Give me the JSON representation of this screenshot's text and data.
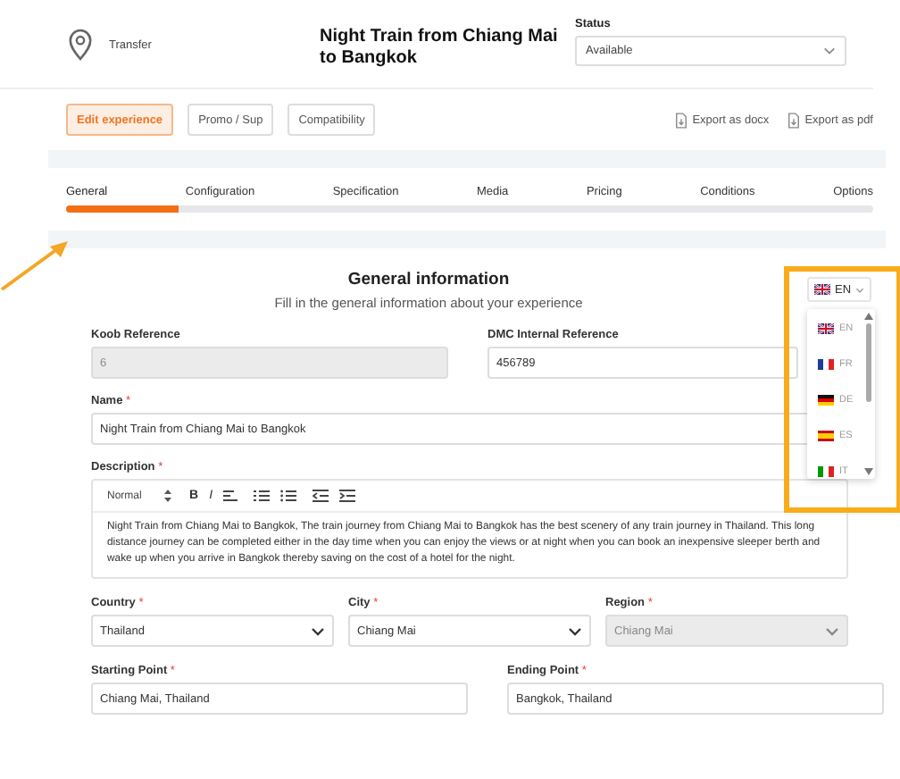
{
  "header": {
    "category": "Transfer",
    "title": "Night Train from Chiang Mai to Bangkok",
    "status": {
      "label": "Status",
      "value": "Available"
    }
  },
  "actions": [
    {
      "label": "Edit experience",
      "selected": true
    },
    {
      "label": "Promo / Sup",
      "selected": false
    },
    {
      "label": "Compatibility",
      "selected": false
    }
  ],
  "exports": [
    "Export as docx",
    "Export as pdf"
  ],
  "tabs": [
    {
      "label": "General",
      "selected": true
    },
    {
      "label": "Configuration",
      "selected": false
    },
    {
      "label": "Specification",
      "selected": false
    },
    {
      "label": "Media",
      "selected": false
    },
    {
      "label": "Pricing",
      "selected": false
    },
    {
      "label": "Conditions",
      "selected": false
    },
    {
      "label": "Options",
      "selected": false
    }
  ],
  "progress": {
    "level": 0.14
  },
  "section": {
    "title": "General information",
    "subtitle": "Fill in the general information about your experience"
  },
  "language": {
    "value": "EN",
    "kind": "uk",
    "options": [
      {
        "code": "EN",
        "kind": "uk"
      },
      {
        "code": "FR",
        "kind": "fr"
      },
      {
        "code": "DE",
        "kind": "de"
      },
      {
        "code": "ES",
        "kind": "es"
      },
      {
        "code": "IT",
        "kind": "it"
      }
    ]
  },
  "references": [
    {
      "label": "Koob Reference",
      "value": "6",
      "disabled": true
    },
    {
      "label": "DMC Internal Reference",
      "value": "456789",
      "disabled": false
    }
  ],
  "name": {
    "label": "Name",
    "mark": "*",
    "value": "Night Train from Chiang Mai to Bangkok"
  },
  "description": {
    "label": "Description",
    "mark": "*",
    "format": "Normal",
    "bold": "B",
    "italic": "I",
    "text": "Night Train from Chiang Mai to Bangkok, The train journey from Chiang Mai to Bangkok has the best scenery of any train journey in Thailand. This long distance journey can be completed either in the day time when you can enjoy the views or at night when you can book an inexpensive sleeper berth and wake up when you arrive in Bangkok thereby saving on the cost of a hotel for the night."
  },
  "location": [
    {
      "label": "Country",
      "mark": "*",
      "value": "Thailand",
      "disabled": false
    },
    {
      "label": "City",
      "mark": "*",
      "value": "Chiang Mai",
      "disabled": false
    },
    {
      "label": "Region",
      "mark": "*",
      "value": "Chiang Mai",
      "disabled": true
    }
  ],
  "points": [
    {
      "label": "Starting Point",
      "mark": "*",
      "value": "Chiang Mai, Thailand"
    },
    {
      "label": "Ending Point",
      "mark": "*",
      "value": "Bangkok, Thailand"
    }
  ]
}
